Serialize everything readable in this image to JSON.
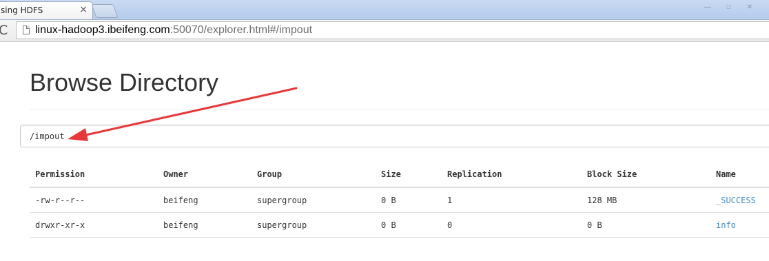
{
  "browser": {
    "tab_title": "sing HDFS",
    "tab_close": "×",
    "window_controls": "— □ ✕",
    "url_host": "linux-hadoop3.ibeifeng.com",
    "url_rest": ":50070/explorer.html#/impout",
    "reload_glyph": "C"
  },
  "page": {
    "title": "Browse Directory",
    "path_value": "/impout"
  },
  "annotation": {
    "arrow_color": "#e8383a"
  },
  "table": {
    "columns": [
      "Permission",
      "Owner",
      "Group",
      "Size",
      "Replication",
      "Block Size",
      "Name"
    ],
    "rows": [
      {
        "permission": "-rw-r--r--",
        "owner": "beifeng",
        "group": "supergroup",
        "size": "0 B",
        "replication": "1",
        "block_size": "128 MB",
        "name": "_SUCCESS"
      },
      {
        "permission": "drwxr-xr-x",
        "owner": "beifeng",
        "group": "supergroup",
        "size": "0 B",
        "replication": "0",
        "block_size": "0 B",
        "name": "info"
      }
    ],
    "link_color": "#428bca"
  }
}
